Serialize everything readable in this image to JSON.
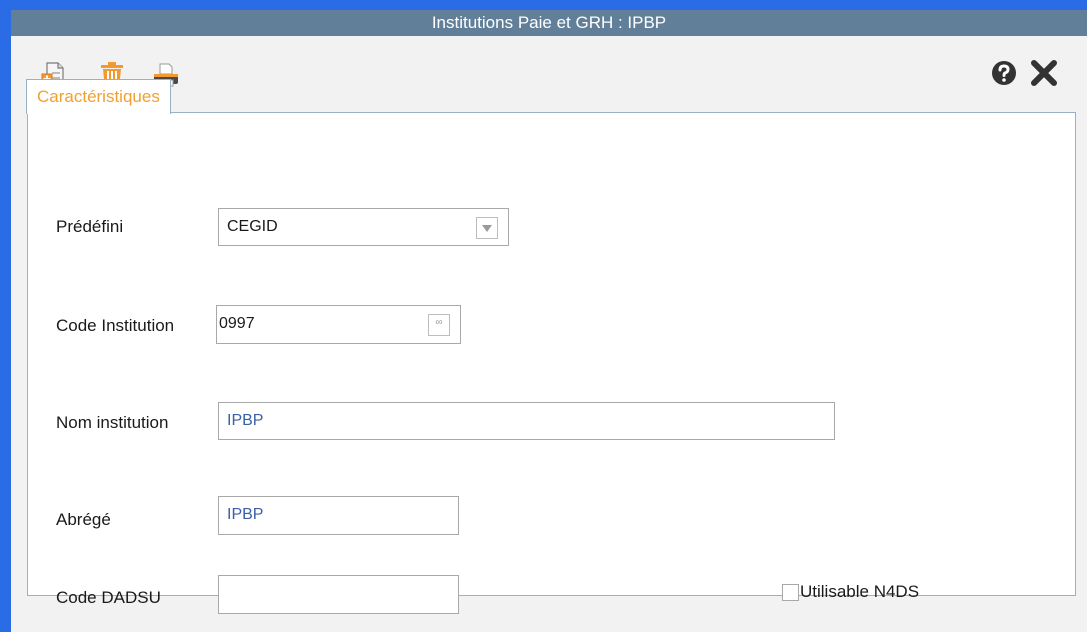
{
  "window": {
    "title": "Institutions Paie et GRH :  IPBP"
  },
  "toolbar": {
    "new_icon": "new-document-icon",
    "delete_icon": "trash-icon",
    "print_icon": "printer-icon",
    "help_icon": "help-icon",
    "close_icon": "close-icon"
  },
  "tabs": [
    {
      "label": "Caractéristiques",
      "active": true
    }
  ],
  "form": {
    "predefini": {
      "label": "Prédéfini",
      "value": "CEGID"
    },
    "code_institution": {
      "label": "Code Institution",
      "value": "0997",
      "button": "∞"
    },
    "nom_institution": {
      "label": "Nom institution",
      "value": "IPBP"
    },
    "abrege": {
      "label": "Abrégé",
      "value": "IPBP"
    },
    "code_dadsu": {
      "label": "Code DADSU",
      "value": ""
    },
    "utilisable_n4ds": {
      "label": "Utilisable N4DS",
      "checked": false
    }
  },
  "colors": {
    "window_border": "#2a6be6",
    "titlebar": "#617f98",
    "tab_text": "#f0a030",
    "field_text_blue": "#3a5fa8"
  }
}
